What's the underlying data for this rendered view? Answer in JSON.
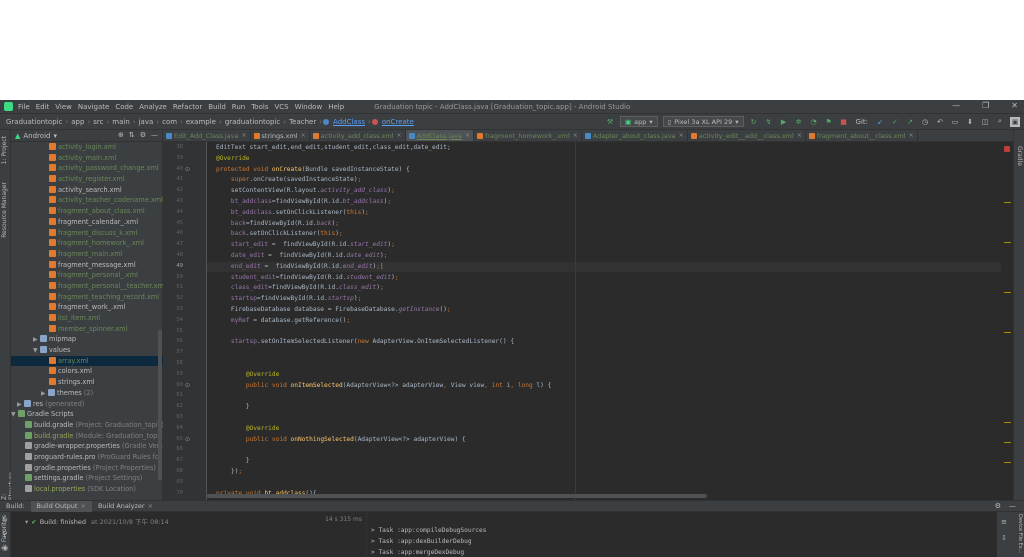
{
  "menubar": {
    "items": [
      "File",
      "Edit",
      "View",
      "Navigate",
      "Code",
      "Analyze",
      "Refactor",
      "Build",
      "Run",
      "Tools",
      "VCS",
      "Window",
      "Help"
    ],
    "window_title": "Graduation topic - AddClass.java [Graduation_topic.app] - Android Studio",
    "controls": [
      "—",
      "❐",
      "✕"
    ]
  },
  "breadcrumb": [
    "Graduationtopic",
    "app",
    "src",
    "main",
    "java",
    "com",
    "example",
    "graduationtopic",
    "Teacher",
    "AddClass",
    "onCreate"
  ],
  "toolbar": {
    "config": "app",
    "device": "Pixel 3a XL API 29",
    "git_label": "Git:"
  },
  "left_tabs": {
    "project": "1: Project",
    "resource_manager": "Resource Manager",
    "structure": "Z: Structure",
    "favorites": "2: Favorites"
  },
  "right_tabs": {
    "gradle": "Gradle",
    "device_explorer": "Device File Ex..."
  },
  "project_panel": {
    "view": "Android",
    "tree": [
      {
        "label": "activity_login.xml",
        "type": "xml",
        "color": "green",
        "indent": 38
      },
      {
        "label": "activity_main.xml",
        "type": "xml",
        "color": "green",
        "indent": 38
      },
      {
        "label": "activity_password_change.xml",
        "type": "xml",
        "color": "green",
        "indent": 38
      },
      {
        "label": "activity_register.xml",
        "type": "xml",
        "color": "green",
        "indent": 38
      },
      {
        "label": "activity_search.xml",
        "type": "xml",
        "color": "plain",
        "indent": 38
      },
      {
        "label": "activity_teacher_codename.xml",
        "type": "xml",
        "color": "green",
        "indent": 38
      },
      {
        "label": "fragment_about_class.xml",
        "type": "xml",
        "color": "green",
        "indent": 38
      },
      {
        "label": "fragment_calendar_.xml",
        "type": "xml",
        "color": "plain",
        "indent": 38
      },
      {
        "label": "fragment_discuss_k.xml",
        "type": "xml",
        "color": "green",
        "indent": 38
      },
      {
        "label": "fragment_homework_.xml",
        "type": "xml",
        "color": "green",
        "indent": 38
      },
      {
        "label": "fragment_main.xml",
        "type": "xml",
        "color": "green",
        "indent": 38
      },
      {
        "label": "fragment_message.xml",
        "type": "xml",
        "color": "plain",
        "indent": 38
      },
      {
        "label": "fragment_personal_.xml",
        "type": "xml",
        "color": "green",
        "indent": 38
      },
      {
        "label": "fragment_personal__teacher.xml",
        "type": "xml",
        "color": "green",
        "indent": 38
      },
      {
        "label": "fragment_teaching_record.xml",
        "type": "xml",
        "color": "green",
        "indent": 38
      },
      {
        "label": "fragment_work_.xml",
        "type": "xml",
        "color": "plain",
        "indent": 38
      },
      {
        "label": "list_item.xml",
        "type": "xml",
        "color": "green",
        "indent": 38
      },
      {
        "label": "member_spinner.xml",
        "type": "xml",
        "color": "green",
        "indent": 38
      },
      {
        "label": "mipmap",
        "type": "folder",
        "color": "plain",
        "indent": 22,
        "arrow": "▶"
      },
      {
        "label": "values",
        "type": "folder",
        "color": "plain",
        "indent": 22,
        "arrow": "▼"
      },
      {
        "label": "array.xml",
        "type": "xml",
        "color": "green",
        "indent": 38,
        "selected": true
      },
      {
        "label": "colors.xml",
        "type": "xml",
        "color": "plain",
        "indent": 38
      },
      {
        "label": "strings.xml",
        "type": "xml",
        "color": "plain",
        "indent": 38
      },
      {
        "label": "themes",
        "suffix": " (2)",
        "type": "folder",
        "color": "plain",
        "indent": 30,
        "arrow": "▶"
      },
      {
        "label": "res",
        "suffix": " (generated)",
        "type": "folder",
        "color": "plain",
        "indent": 6,
        "arrow": "▶"
      },
      {
        "label": "Gradle Scripts",
        "type": "gradle",
        "color": "plain",
        "indent": 0,
        "arrow": "▼"
      },
      {
        "label": "build.gradle",
        "suffix": " (Project: Graduation_topic)",
        "type": "gradle",
        "color": "plain",
        "indent": 14
      },
      {
        "label": "build.gradle",
        "suffix": " (Module: Graduation_topic)",
        "type": "gradle",
        "color": "olive",
        "indent": 14
      },
      {
        "label": "gradle-wrapper.properties",
        "suffix": " (Gradle Vers",
        "type": "props",
        "color": "plain",
        "indent": 14
      },
      {
        "label": "proguard-rules.pro",
        "suffix": " (ProGuard Rules for G",
        "type": "props",
        "color": "plain",
        "indent": 14
      },
      {
        "label": "gradle.properties",
        "suffix": " (Project Properties)",
        "type": "props",
        "color": "plain",
        "indent": 14
      },
      {
        "label": "settings.gradle",
        "suffix": " (Project Settings)",
        "type": "gradle",
        "color": "plain",
        "indent": 14
      },
      {
        "label": "local.properties",
        "suffix": " (SDK Location)",
        "type": "props",
        "color": "olive",
        "indent": 14
      }
    ]
  },
  "tabs": [
    {
      "label": "Edit_Add_Class.java",
      "icon": "#4a88c7",
      "color": "#6a8759"
    },
    {
      "label": "strings.xml",
      "icon": "#e07a2f",
      "color": "#bbbbbb"
    },
    {
      "label": "activity_add_class.xml",
      "icon": "#e07a2f",
      "color": "#6a8759"
    },
    {
      "label": "AddClass.java",
      "icon": "#4a88c7",
      "color": "#6a8759",
      "active": true
    },
    {
      "label": "fragment_homework_.xml",
      "icon": "#e07a2f",
      "color": "#6a8759"
    },
    {
      "label": "Adapter_about_class.java",
      "icon": "#4a88c7",
      "color": "#6a8759"
    },
    {
      "label": "activity_edit__add__class.xml",
      "icon": "#e07a2f",
      "color": "#6a8759"
    },
    {
      "label": "fragment_about__class.xml",
      "icon": "#e07a2f",
      "color": "#6a8759"
    }
  ],
  "line_numbers": [
    "38",
    "39",
    "40",
    "41",
    "42",
    "43",
    "44",
    "45",
    "46",
    "47",
    "48",
    "49",
    "50",
    "51",
    "52",
    "53",
    "54",
    "55",
    "56",
    "57",
    "58",
    "59",
    "60",
    "61",
    "62",
    "63",
    "64",
    "65",
    "66",
    "67",
    "68",
    "69",
    "70"
  ],
  "current_line": "49",
  "build": {
    "label": "Build:",
    "tabs": [
      "Build Output",
      "Build Analyzer"
    ],
    "status": "Build: finished",
    "status_time": "at 2021/10/8 下午 08:14",
    "duration": "14 s 315 ms",
    "console": [
      "> Task :app:compileDebugSources",
      "> Task :app:dexBuilderDebug",
      "> Task :app:mergeDexDebug"
    ]
  }
}
